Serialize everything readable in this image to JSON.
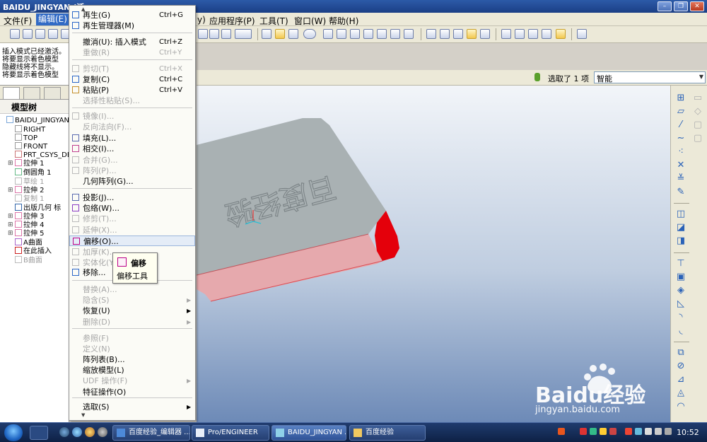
{
  "window": {
    "title": "BAIDU_JINGYAN (活",
    "min_label": "–",
    "max_label": "❐",
    "close_label": "✕"
  },
  "menubar": {
    "items": [
      "文件(F)",
      "编辑(E)",
      "应用程序(P)",
      "工具(T)",
      "窗口(W)",
      "帮助(H)"
    ],
    "partial_item": "y)"
  },
  "messages": [
    "插入模式已经激活。",
    "将要显示着色模型",
    "隐藏线将不显示。",
    "将要显示着色模型"
  ],
  "selection": {
    "text": "选取了 1 项",
    "filter_value": "智能"
  },
  "model_tree": {
    "header": "模型树",
    "nodes": [
      {
        "label": "BAIDU_JINGYAN.",
        "state": "normal"
      },
      {
        "label": "RIGHT",
        "state": "normal"
      },
      {
        "label": "TOP",
        "state": "normal"
      },
      {
        "label": "FRONT",
        "state": "normal"
      },
      {
        "label": "PRT_CSYS_DE",
        "state": "normal"
      },
      {
        "label": "拉伸 1",
        "state": "normal"
      },
      {
        "label": "倒圆角 1",
        "state": "normal"
      },
      {
        "label": "草绘 1",
        "state": "disabled"
      },
      {
        "label": "拉伸 2",
        "state": "normal"
      },
      {
        "label": "复制 1",
        "state": "disabled"
      },
      {
        "label": "出版几何 标",
        "state": "normal"
      },
      {
        "label": "拉伸 3",
        "state": "normal"
      },
      {
        "label": "拉伸 4",
        "state": "normal"
      },
      {
        "label": "拉伸 5",
        "state": "normal"
      },
      {
        "label": "A曲面",
        "state": "normal"
      },
      {
        "label": "在此插入",
        "state": "normal"
      },
      {
        "label": "B曲面",
        "state": "disabled"
      }
    ]
  },
  "edit_menu": {
    "top_arrow": "▲",
    "bottom_arrow": "▼",
    "items": [
      {
        "label": "再生(G)",
        "shortcut": "Ctrl+G",
        "state": "enabled"
      },
      {
        "label": "再生管理器(M)",
        "shortcut": "",
        "state": "enabled"
      },
      {
        "label": "撤消(U):  插入模式",
        "shortcut": "Ctrl+Z",
        "state": "enabled"
      },
      {
        "label": "重做(R)",
        "shortcut": "Ctrl+Y",
        "state": "disabled"
      },
      {
        "label": "剪切(T)",
        "shortcut": "Ctrl+X",
        "state": "disabled"
      },
      {
        "label": "复制(C)",
        "shortcut": "Ctrl+C",
        "state": "enabled"
      },
      {
        "label": "粘贴(P)",
        "shortcut": "Ctrl+V",
        "state": "enabled"
      },
      {
        "label": "选择性粘贴(S)...",
        "shortcut": "",
        "state": "disabled"
      },
      {
        "label": "镜像(I)...",
        "shortcut": "",
        "state": "disabled"
      },
      {
        "label": "反向法向(F)...",
        "shortcut": "",
        "state": "disabled"
      },
      {
        "label": "填充(L)...",
        "shortcut": "",
        "state": "enabled"
      },
      {
        "label": "相交(I)...",
        "shortcut": "",
        "state": "enabled"
      },
      {
        "label": "合并(G)...",
        "shortcut": "",
        "state": "disabled"
      },
      {
        "label": "阵列(P)...",
        "shortcut": "",
        "state": "disabled"
      },
      {
        "label": "几何阵列(G)...",
        "shortcut": "",
        "state": "enabled"
      },
      {
        "label": "投影(J)...",
        "shortcut": "",
        "state": "enabled"
      },
      {
        "label": "包络(W)...",
        "shortcut": "",
        "state": "enabled"
      },
      {
        "label": "修剪(T)...",
        "shortcut": "",
        "state": "disabled"
      },
      {
        "label": "延伸(X)...",
        "shortcut": "",
        "state": "disabled"
      },
      {
        "label": "偏移(O)...",
        "shortcut": "",
        "state": "highlighted"
      },
      {
        "label": "加厚(K)...",
        "shortcut": "",
        "state": "disabled"
      },
      {
        "label": "实体化(Y)...",
        "shortcut": "",
        "state": "disabled"
      },
      {
        "label": "移除...",
        "shortcut": "",
        "state": "enabled"
      },
      {
        "label": "替换(A)...",
        "shortcut": "",
        "state": "disabled"
      },
      {
        "label": "隐含(S)",
        "shortcut": "",
        "state": "disabled",
        "submenu": true
      },
      {
        "label": "恢复(U)",
        "shortcut": "",
        "state": "enabled",
        "submenu": true
      },
      {
        "label": "删除(D)",
        "shortcut": "",
        "state": "disabled",
        "submenu": true
      },
      {
        "label": "参照(F)",
        "shortcut": "",
        "state": "disabled"
      },
      {
        "label": "定义(N)",
        "shortcut": "",
        "state": "disabled"
      },
      {
        "label": "阵列表(B)...",
        "shortcut": "",
        "state": "enabled"
      },
      {
        "label": "缩放模型(L)",
        "shortcut": "",
        "state": "enabled"
      },
      {
        "label": "UDF 操作(F)",
        "shortcut": "",
        "state": "disabled",
        "submenu": true
      },
      {
        "label": "特征操作(O)",
        "shortcut": "",
        "state": "enabled"
      },
      {
        "label": "选取(S)",
        "shortcut": "",
        "state": "enabled",
        "submenu": true
      }
    ]
  },
  "tooltip": {
    "title": "偏移",
    "desc": "偏移工具"
  },
  "model": {
    "engraved_text": "百度经验",
    "top_color": "#a9b1b3",
    "side_color": "#e6a9ad",
    "end_color": "#e4000b"
  },
  "taskbar": {
    "buttons": [
      "百度经验_编辑器 ...",
      "Pro/ENGINEER",
      "BAIDU_JINGYAN ...",
      "百度经验"
    ],
    "clock": "10:52"
  },
  "watermark": {
    "logo_text": "Baidu经验",
    "url": "jingyan.baidu.com"
  }
}
